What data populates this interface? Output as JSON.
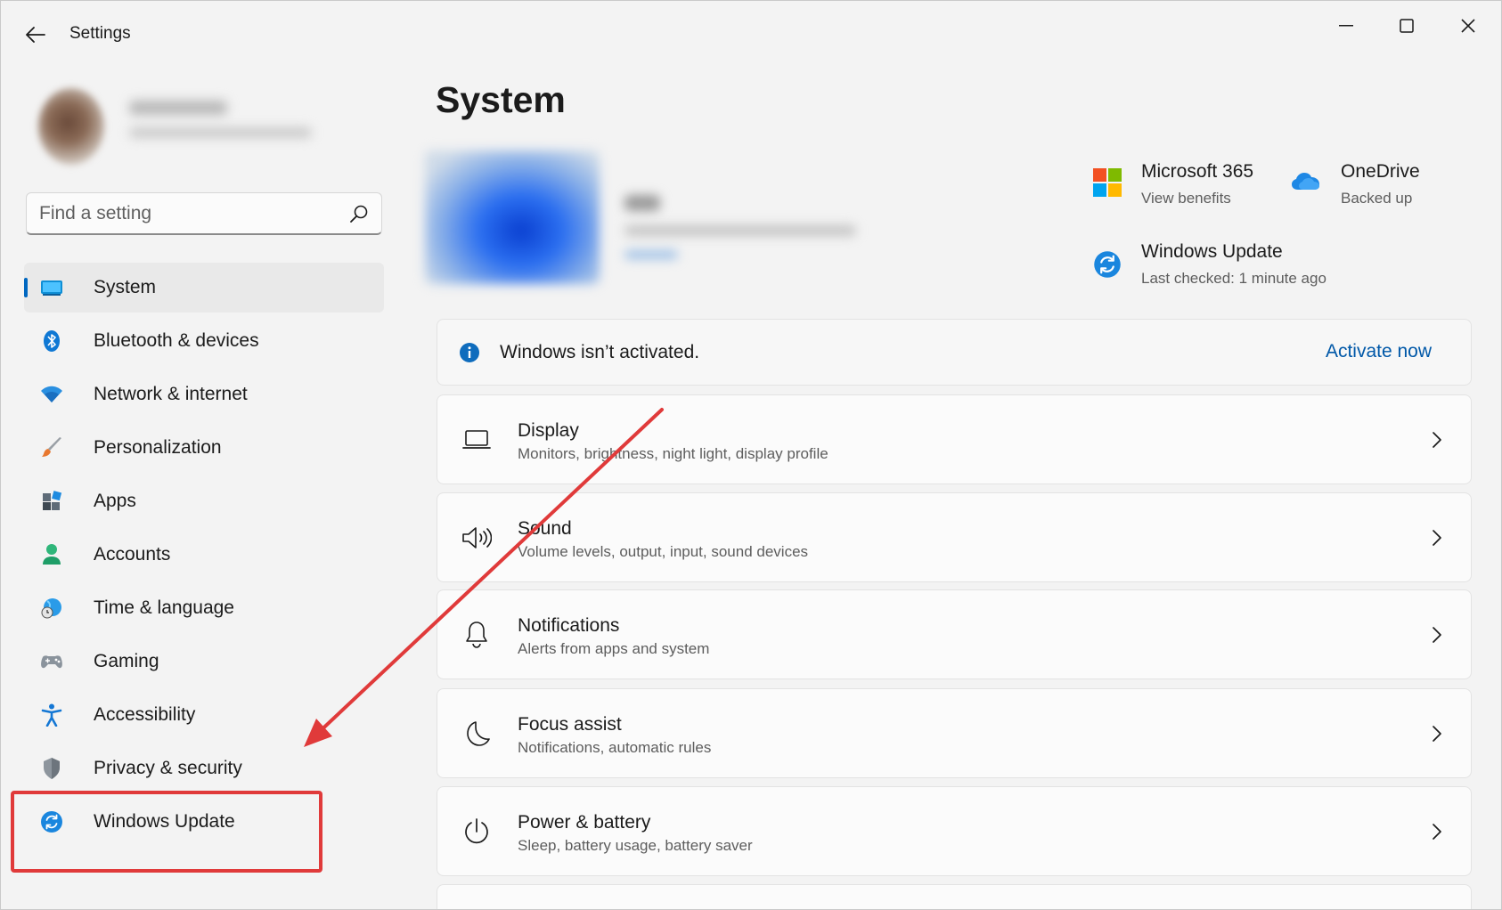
{
  "window": {
    "title": "Settings"
  },
  "search": {
    "placeholder": "Find a setting"
  },
  "sidebar": {
    "items": [
      {
        "label": "System",
        "icon": "system-icon"
      },
      {
        "label": "Bluetooth & devices",
        "icon": "bluetooth-icon"
      },
      {
        "label": "Network & internet",
        "icon": "wifi-icon"
      },
      {
        "label": "Personalization",
        "icon": "brush-icon"
      },
      {
        "label": "Apps",
        "icon": "apps-icon"
      },
      {
        "label": "Accounts",
        "icon": "accounts-icon"
      },
      {
        "label": "Time & language",
        "icon": "globe-clock-icon"
      },
      {
        "label": "Gaming",
        "icon": "gamepad-icon"
      },
      {
        "label": "Accessibility",
        "icon": "accessibility-icon"
      },
      {
        "label": "Privacy & security",
        "icon": "shield-icon"
      },
      {
        "label": "Windows Update",
        "icon": "windows-update-icon"
      }
    ],
    "active_index": 0
  },
  "main": {
    "title": "System",
    "tiles": {
      "m365": {
        "title": "Microsoft 365",
        "subtitle": "View benefits"
      },
      "onedrive": {
        "title": "OneDrive",
        "subtitle": "Backed up"
      },
      "update": {
        "title": "Windows Update",
        "subtitle": "Last checked: 1 minute ago"
      }
    },
    "banner": {
      "message": "Windows isn’t activated.",
      "action": "Activate now"
    },
    "cards": [
      {
        "title": "Display",
        "subtitle": "Monitors, brightness, night light, display profile",
        "icon": "laptop-icon"
      },
      {
        "title": "Sound",
        "subtitle": "Volume levels, output, input, sound devices",
        "icon": "speaker-icon"
      },
      {
        "title": "Notifications",
        "subtitle": "Alerts from apps and system",
        "icon": "bell-icon"
      },
      {
        "title": "Focus assist",
        "subtitle": "Notifications, automatic rules",
        "icon": "moon-icon"
      },
      {
        "title": "Power & battery",
        "subtitle": "Sleep, battery usage, battery saver",
        "icon": "power-icon"
      }
    ]
  },
  "colors": {
    "accent": "#0067c0",
    "link": "#0058a8",
    "annotation": "#e03a3a"
  }
}
